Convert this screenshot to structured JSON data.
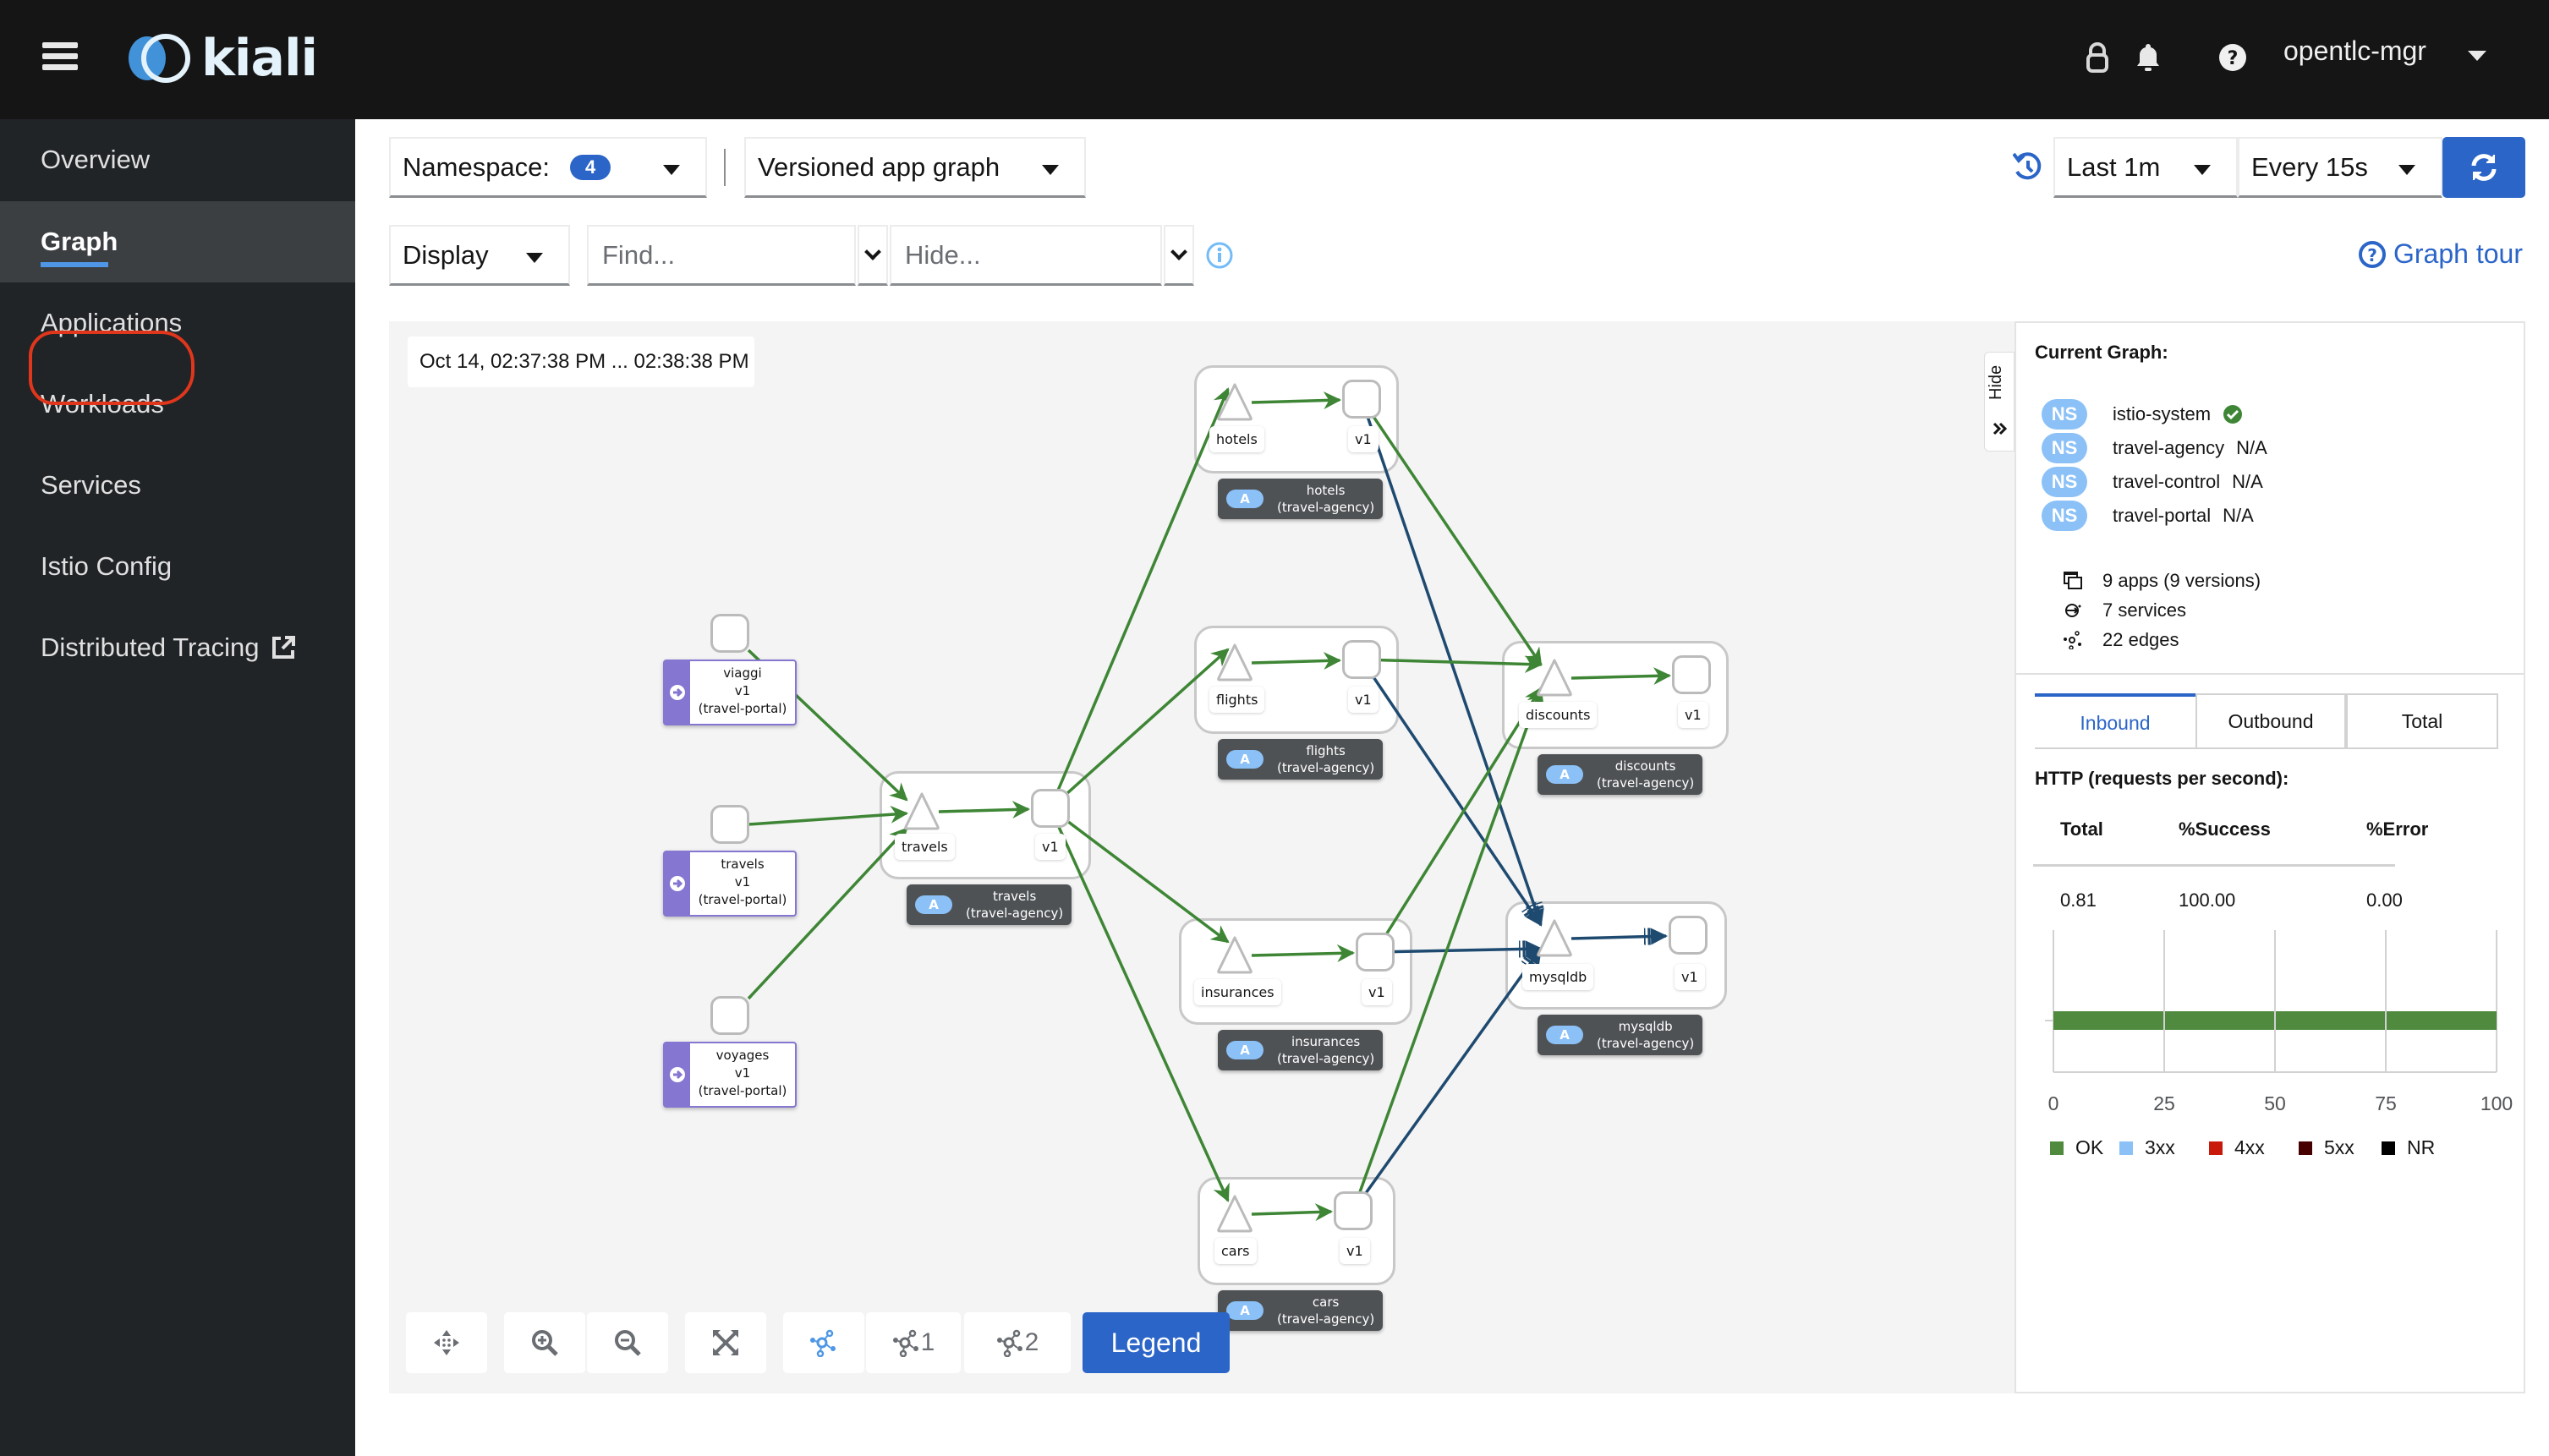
{
  "header": {
    "brand": "kiali",
    "user": "opentlc-mgr",
    "icons": [
      "menu-icon",
      "lock-icon",
      "bell-icon",
      "help-icon"
    ]
  },
  "sidebar": {
    "items": [
      {
        "label": "Overview",
        "active": false
      },
      {
        "label": "Graph",
        "active": true
      },
      {
        "label": "Applications",
        "active": false
      },
      {
        "label": "Workloads",
        "active": false
      },
      {
        "label": "Services",
        "active": false
      },
      {
        "label": "Istio Config",
        "active": false
      },
      {
        "label": "Distributed Tracing",
        "active": false,
        "external": true
      }
    ]
  },
  "toolbar": {
    "namespace_label": "Namespace:",
    "namespace_count": "4",
    "graph_type": "Versioned app graph",
    "display_label": "Display",
    "find_placeholder": "Find...",
    "hide_placeholder": "Hide...",
    "time_range": "Last 1m",
    "refresh_interval": "Every 15s",
    "graph_tour": "Graph tour"
  },
  "graph": {
    "timestamp": "Oct 14, 02:37:38 PM ... 02:38:38 PM",
    "colors": {
      "ok_edge": "#3e8635",
      "tcp_edge": "#1f4a70",
      "portal": "#8476d1",
      "app_badge": "#8bc1f7"
    },
    "app_badge_letter": "A",
    "portal_nodes": [
      {
        "id": "viaggi",
        "name": "viaggi",
        "version": "v1",
        "namespace": "(travel-portal)"
      },
      {
        "id": "travels-portal",
        "name": "travels",
        "version": "v1",
        "namespace": "(travel-portal)"
      },
      {
        "id": "voyages",
        "name": "voyages",
        "version": "v1",
        "namespace": "(travel-portal)"
      }
    ],
    "apps": [
      {
        "id": "travels",
        "service": "travels",
        "version": "v1",
        "name": "travels",
        "namespace": "(travel-agency)"
      },
      {
        "id": "hotels",
        "service": "hotels",
        "version": "v1",
        "name": "hotels",
        "namespace": "(travel-agency)"
      },
      {
        "id": "flights",
        "service": "flights",
        "version": "v1",
        "name": "flights",
        "namespace": "(travel-agency)"
      },
      {
        "id": "insurances",
        "service": "insurances",
        "version": "v1",
        "name": "insurances",
        "namespace": "(travel-agency)"
      },
      {
        "id": "cars",
        "service": "cars",
        "version": "v1",
        "name": "cars",
        "namespace": "(travel-agency)"
      },
      {
        "id": "discounts",
        "service": "discounts",
        "version": "v1",
        "name": "discounts",
        "namespace": "(travel-agency)"
      },
      {
        "id": "mysqldb",
        "service": "mysqldb",
        "version": "v1",
        "name": "mysqldb",
        "namespace": "(travel-agency)"
      }
    ],
    "edges": [
      {
        "from": "viaggi",
        "to": "travels",
        "protocol": "http"
      },
      {
        "from": "travels-portal",
        "to": "travels",
        "protocol": "http"
      },
      {
        "from": "voyages",
        "to": "travels",
        "protocol": "http"
      },
      {
        "from": "travels",
        "to": "hotels",
        "protocol": "http"
      },
      {
        "from": "travels",
        "to": "flights",
        "protocol": "http"
      },
      {
        "from": "travels",
        "to": "insurances",
        "protocol": "http"
      },
      {
        "from": "travels",
        "to": "cars",
        "protocol": "http"
      },
      {
        "from": "hotels",
        "to": "discounts",
        "protocol": "http"
      },
      {
        "from": "hotels",
        "to": "mysqldb",
        "protocol": "tcp"
      },
      {
        "from": "flights",
        "to": "discounts",
        "protocol": "http"
      },
      {
        "from": "flights",
        "to": "mysqldb",
        "protocol": "tcp"
      },
      {
        "from": "insurances",
        "to": "discounts",
        "protocol": "http"
      },
      {
        "from": "insurances",
        "to": "mysqldb",
        "protocol": "tcp"
      },
      {
        "from": "cars",
        "to": "discounts",
        "protocol": "http"
      },
      {
        "from": "cars",
        "to": "mysqldb",
        "protocol": "tcp"
      }
    ],
    "bottom_toolbar": {
      "buttons": [
        "pan-icon",
        "zoom-in-icon",
        "zoom-out-icon",
        "fit-icon",
        "layout-default-icon",
        "layout-1-icon",
        "layout-2-icon"
      ],
      "layout1_label": "1",
      "layout2_label": "2",
      "legend_label": "Legend"
    },
    "hide_tab_label": "Hide"
  },
  "side_panel": {
    "title": "Current Graph:",
    "namespaces": [
      {
        "badge": "NS",
        "name": "istio-system",
        "status": "healthy"
      },
      {
        "badge": "NS",
        "name": "travel-agency",
        "status": "N/A"
      },
      {
        "badge": "NS",
        "name": "travel-control",
        "status": "N/A"
      },
      {
        "badge": "NS",
        "name": "travel-portal",
        "status": "N/A"
      }
    ],
    "stats": {
      "apps": "9 apps (9 versions)",
      "services": "7 services",
      "edges": "22 edges"
    },
    "tabs": [
      {
        "label": "Inbound",
        "active": true
      },
      {
        "label": "Outbound",
        "active": false
      },
      {
        "label": "Total",
        "active": false
      }
    ],
    "http_title": "HTTP (requests per second):",
    "table": {
      "headers": [
        "Total",
        "%Success",
        "%Error"
      ],
      "row": [
        "0.81",
        "100.00",
        "0.00"
      ]
    }
  },
  "chart_data": {
    "type": "bar",
    "orientation": "horizontal",
    "stacked": true,
    "categories": [
      ""
    ],
    "series": [
      {
        "name": "OK",
        "values": [
          100
        ],
        "color": "#4f8a3e"
      },
      {
        "name": "3xx",
        "values": [
          0
        ],
        "color": "#8bc1f7"
      },
      {
        "name": "4xx",
        "values": [
          0
        ],
        "color": "#c9190b"
      },
      {
        "name": "5xx",
        "values": [
          0
        ],
        "color": "#470000"
      },
      {
        "name": "NR",
        "values": [
          0
        ],
        "color": "#000000"
      }
    ],
    "xlim": [
      0,
      100
    ],
    "xticks": [
      "0",
      "25",
      "50",
      "75",
      "100"
    ],
    "grid": true,
    "legend": "bottom"
  }
}
